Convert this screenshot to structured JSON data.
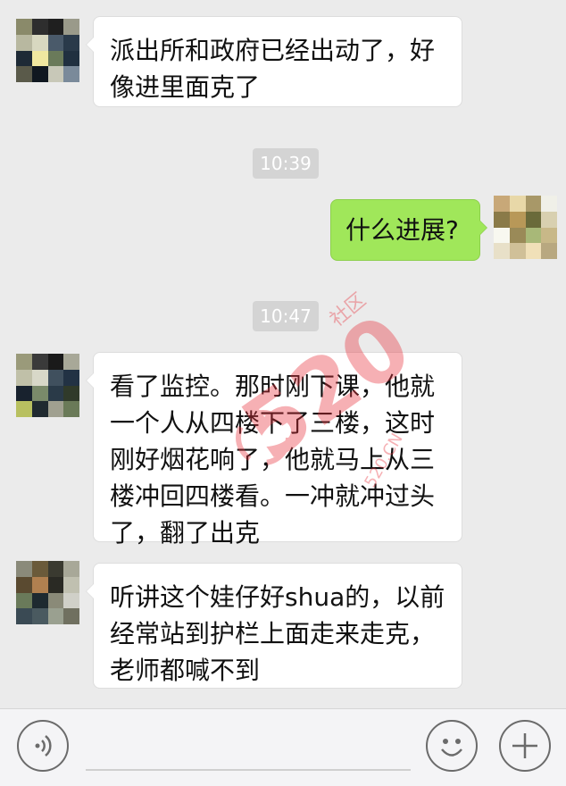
{
  "conversation": {
    "messages": [
      {
        "side": "incoming",
        "text": "派出所和政府已经出动了，好像进里面克了"
      },
      {
        "side": "outgoing",
        "text": "什么进展?"
      },
      {
        "side": "incoming",
        "text": "看了监控。那时刚下课，他就一个人从四楼下了三楼，这时刚好烟花响了，他就马上从三楼冲回四楼看。一冲就冲过头了，翻了出克"
      },
      {
        "side": "incoming",
        "text": "听讲这个娃仔好shua的，以前经常站到护栏上面走来走克，老师都喊不到"
      }
    ],
    "timestamps": [
      "10:39",
      "10:47"
    ]
  },
  "watermark": {
    "text": "520",
    "site": "520.CN",
    "vertical": "社区"
  },
  "input_bar": {
    "voice_icon": "voice-icon",
    "emoji_icon": "emoji-icon",
    "plus_icon": "plus-icon",
    "message_text": ""
  },
  "colors": {
    "chat_background": "#ebebeb",
    "incoming_bubble": "#ffffff",
    "outgoing_bubble": "#a0e75a",
    "timestamp_background": "#d4d4d4",
    "watermark": "#e8323c"
  }
}
